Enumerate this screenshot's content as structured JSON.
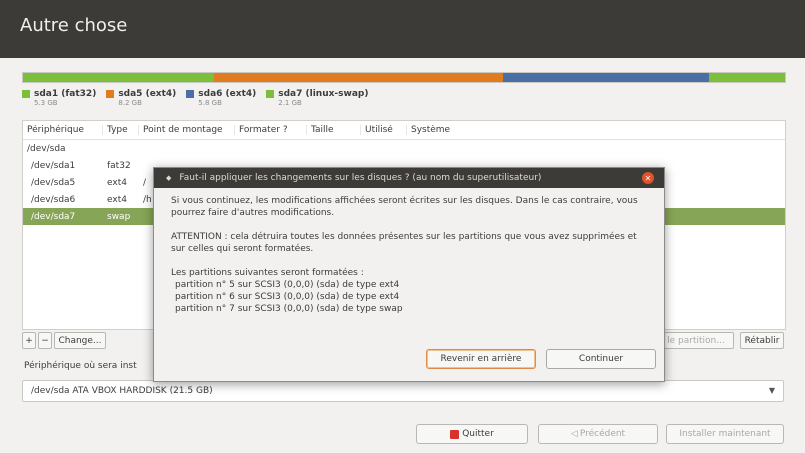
{
  "window": {
    "title": "Autre chose"
  },
  "disk_bar": {
    "segments": [
      {
        "color": "#7bbf3a",
        "fraction": 0.25
      },
      {
        "color": "#e07b1e",
        "fraction": 0.38
      },
      {
        "color": "#4a6fa5",
        "fraction": 0.27
      },
      {
        "color": "#7bbf3a",
        "fraction": 0.1
      }
    ]
  },
  "legend": [
    {
      "name": "sda1 (fat32)",
      "size": "5.3 GB",
      "color": "#7bbf3a"
    },
    {
      "name": "sda5 (ext4)",
      "size": "8.2 GB",
      "color": "#e07b1e"
    },
    {
      "name": "sda6 (ext4)",
      "size": "5.8 GB",
      "color": "#4a6fa5"
    },
    {
      "name": "sda7 (linux-swap)",
      "size": "2.1 GB",
      "color": "#7bbf3a"
    }
  ],
  "table": {
    "headers": [
      "Périphérique",
      "Type",
      "Point de montage",
      "Formater ?",
      "Taille",
      "Utilisé",
      "Système"
    ],
    "rows": [
      {
        "device": "/dev/sda",
        "type": "",
        "mount": ""
      },
      {
        "device": "/dev/sda1",
        "type": "fat32",
        "mount": ""
      },
      {
        "device": "/dev/sda5",
        "type": "ext4",
        "mount": "/"
      },
      {
        "device": "/dev/sda6",
        "type": "ext4",
        "mount": "/h"
      },
      {
        "device": "/dev/sda7",
        "type": "swap",
        "mount": ""
      }
    ]
  },
  "table_buttons": {
    "add": "+",
    "remove": "−",
    "change": "Change...",
    "new_partition": "le partition...",
    "restore": "Rétablir"
  },
  "boot_label": "Périphérique où sera inst",
  "boot_device": "/dev/sda   ATA VBOX HARDDISK (21.5 GB)",
  "dialog": {
    "title": "Faut-il appliquer les changements sur les disques ? (au nom du superutilisateur)",
    "p1": "Si vous continuez, les modifications affichées seront écrites sur les disques. Dans le cas contraire, vous pourrez faire d'autres modifications.",
    "p2": "ATTENTION : cela détruira toutes les données présentes sur les partitions que vous avez supprimées et sur celles qui seront formatées.",
    "p3_title": "Les partitions suivantes seront formatées :",
    "partitions": [
      "partition n° 5 sur SCSI3 (0,0,0) (sda) de type ext4",
      "partition n° 6 sur SCSI3 (0,0,0) (sda) de type ext4",
      "partition n° 7 sur SCSI3 (0,0,0) (sda) de type swap"
    ],
    "back_button": "Revenir en arrière",
    "continue_button": "Continuer"
  },
  "footer": {
    "quit": "Quitter",
    "previous": "Précédent",
    "install": "Installer maintenant"
  }
}
